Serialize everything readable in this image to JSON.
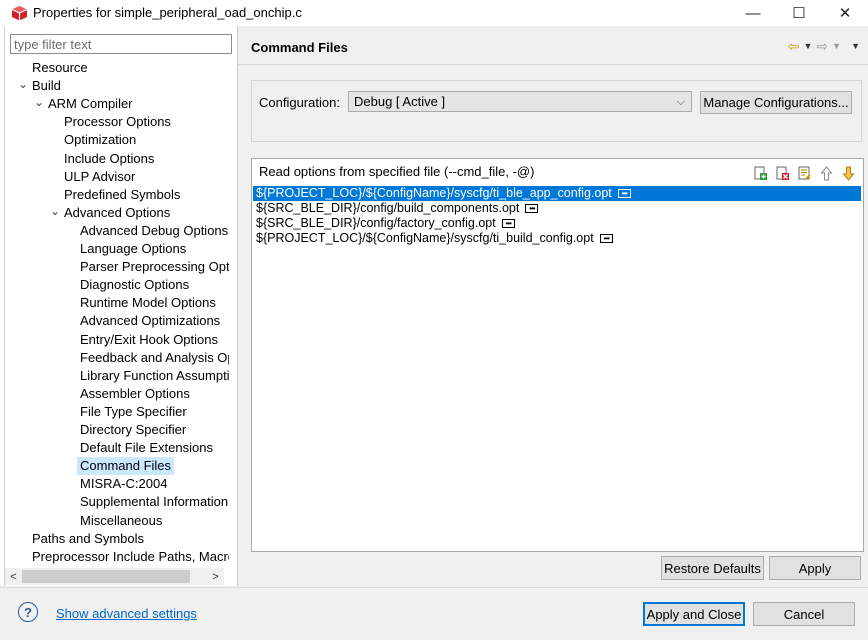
{
  "window": {
    "title": "Properties for simple_peripheral_oad_onchip.c",
    "icon": "project-cube-icon",
    "minimize": "—",
    "maximize": "☐",
    "close": "✕"
  },
  "filter": {
    "placeholder": "type filter text",
    "value": ""
  },
  "tree": [
    {
      "label": "Resource",
      "level": 1,
      "expand": ""
    },
    {
      "label": "Build",
      "level": 1,
      "expand": "open"
    },
    {
      "label": "ARM Compiler",
      "level": 2,
      "expand": "open"
    },
    {
      "label": "Processor Options",
      "level": 3,
      "expand": ""
    },
    {
      "label": "Optimization",
      "level": 3,
      "expand": ""
    },
    {
      "label": "Include Options",
      "level": 3,
      "expand": ""
    },
    {
      "label": "ULP Advisor",
      "level": 3,
      "expand": ""
    },
    {
      "label": "Predefined Symbols",
      "level": 3,
      "expand": ""
    },
    {
      "label": "Advanced Options",
      "level": 3,
      "expand": "open"
    },
    {
      "label": "Advanced Debug Options",
      "level": 4,
      "expand": ""
    },
    {
      "label": "Language Options",
      "level": 4,
      "expand": ""
    },
    {
      "label": "Parser Preprocessing Optio",
      "level": 4,
      "expand": ""
    },
    {
      "label": "Diagnostic Options",
      "level": 4,
      "expand": ""
    },
    {
      "label": "Runtime Model Options",
      "level": 4,
      "expand": ""
    },
    {
      "label": "Advanced Optimizations",
      "level": 4,
      "expand": ""
    },
    {
      "label": "Entry/Exit Hook Options",
      "level": 4,
      "expand": ""
    },
    {
      "label": "Feedback and Analysis Op",
      "level": 4,
      "expand": ""
    },
    {
      "label": "Library Function Assumptio",
      "level": 4,
      "expand": ""
    },
    {
      "label": "Assembler Options",
      "level": 4,
      "expand": ""
    },
    {
      "label": "File Type Specifier",
      "level": 4,
      "expand": ""
    },
    {
      "label": "Directory Specifier",
      "level": 4,
      "expand": ""
    },
    {
      "label": "Default File Extensions",
      "level": 4,
      "expand": ""
    },
    {
      "label": "Command Files",
      "level": 4,
      "expand": "",
      "selected": true
    },
    {
      "label": "MISRA-C:2004",
      "level": 4,
      "expand": ""
    },
    {
      "label": "Supplemental Information",
      "level": 4,
      "expand": ""
    },
    {
      "label": "Miscellaneous",
      "level": 4,
      "expand": ""
    },
    {
      "label": "Paths and Symbols",
      "level": 1,
      "expand": ""
    },
    {
      "label": "Preprocessor Include Paths, Macros",
      "level": 1,
      "expand": ""
    }
  ],
  "page": {
    "title": "Command Files",
    "configuration_label": "Configuration:",
    "configuration_value": "Debug  [ Active ]",
    "manage_button": "Manage Configurations...",
    "files_title": "Read options from specified file (--cmd_file, -@)",
    "file_tools": [
      "add-file-icon",
      "delete-file-icon",
      "edit-file-icon",
      "move-up-icon",
      "move-down-icon"
    ],
    "files": [
      "${PROJECT_LOC}/${ConfigName}/syscfg/ti_ble_app_config.opt",
      "${SRC_BLE_DIR}/config/build_components.opt",
      "${SRC_BLE_DIR}/config/factory_config.opt",
      "${PROJECT_LOC}/${ConfigName}/syscfg/ti_build_config.opt"
    ],
    "selected_file_index": 0,
    "restore_defaults": "Restore Defaults",
    "apply": "Apply"
  },
  "footer": {
    "help": "?",
    "advanced_link": "Show advanced settings",
    "apply_close": "Apply and Close",
    "cancel": "Cancel"
  },
  "colors": {
    "selection": "#0078d7",
    "tree_selection": "#cce8ff",
    "link": "#0066cc",
    "accent_icon": "#d0202a"
  }
}
